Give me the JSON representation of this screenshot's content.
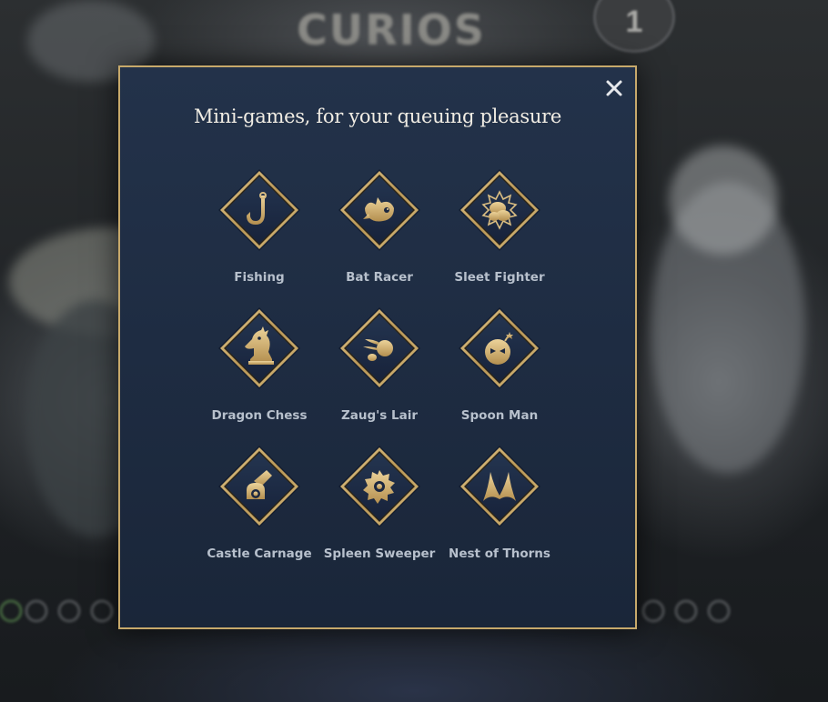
{
  "background": {
    "title_small": "",
    "title": "CURIOS",
    "badge": "1",
    "left_caption": "",
    "right_caption": "",
    "bottom_left": "",
    "bottom_right": ""
  },
  "modal": {
    "title": "Mini-games, for your queuing pleasure",
    "close_icon": "close-icon",
    "accent_color": "#c7a96b",
    "games": [
      {
        "label": "Fishing",
        "icon": "fishing-hook-icon"
      },
      {
        "label": "Bat Racer",
        "icon": "bat-icon"
      },
      {
        "label": "Sleet Fighter",
        "icon": "fist-icon"
      },
      {
        "label": "Dragon Chess",
        "icon": "dragon-chess-icon"
      },
      {
        "label": "Zaug's Lair",
        "icon": "fireball-icon"
      },
      {
        "label": "Spoon Man",
        "icon": "bomb-face-icon"
      },
      {
        "label": "Castle Carnage",
        "icon": "cannon-icon"
      },
      {
        "label": "Spleen Sweeper",
        "icon": "mine-icon"
      },
      {
        "label": "Nest of Thorns",
        "icon": "thorns-icon"
      }
    ]
  }
}
